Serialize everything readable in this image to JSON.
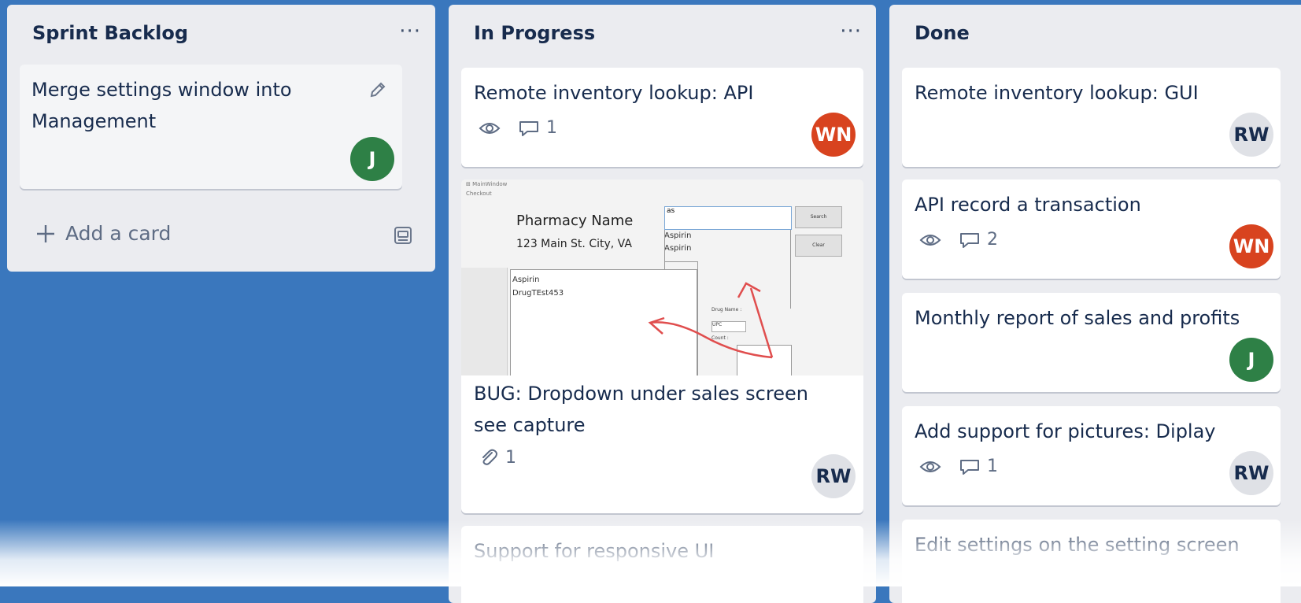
{
  "lists": {
    "backlog": {
      "title": "Sprint Backlog",
      "menu": "···",
      "cards": [
        {
          "title": "Merge settings window into Management",
          "member": "J"
        }
      ],
      "add_card_label": "Add a card"
    },
    "progress": {
      "title": "In Progress",
      "menu": "···",
      "cards": [
        {
          "title": "Remote inventory lookup: API",
          "comments": "1",
          "member": "WN"
        },
        {
          "title": "BUG: Dropdown under sales screen see capture",
          "attachments": "1",
          "member": "RW",
          "cover": {
            "pharmacy_name": "Pharmacy Name",
            "address": "123 Main St. City, VA",
            "search_value": "as",
            "search_button": "Search",
            "clear_button": "Clear",
            "dropdown_items": [
              "Aspirin",
              "Aspirin"
            ],
            "list_items": [
              "Aspirin",
              "DrugTEst453"
            ],
            "drug_name_label": "Drug Name :",
            "upc_option": "UPC",
            "count_label": "Count :"
          }
        },
        {
          "title": "Support for responsive UI"
        }
      ]
    },
    "done": {
      "title": "Done",
      "menu": "···",
      "cards": [
        {
          "title": "Remote inventory lookup: GUI",
          "member": "RW"
        },
        {
          "title": "API record a transaction",
          "comments": "2",
          "member": "WN"
        },
        {
          "title": "Monthly report of sales and profits",
          "member": "J"
        },
        {
          "title": "Add support for pictures: Diplay",
          "comments": "1",
          "member": "RW"
        },
        {
          "title": "Edit settings on the setting screen"
        }
      ]
    }
  },
  "colors": {
    "board_background": "#3a77bd",
    "list_background": "#ebecf0",
    "avatar_wn": "#d8431f",
    "avatar_j": "#2e8046",
    "avatar_rw": "#dfe1e6"
  }
}
